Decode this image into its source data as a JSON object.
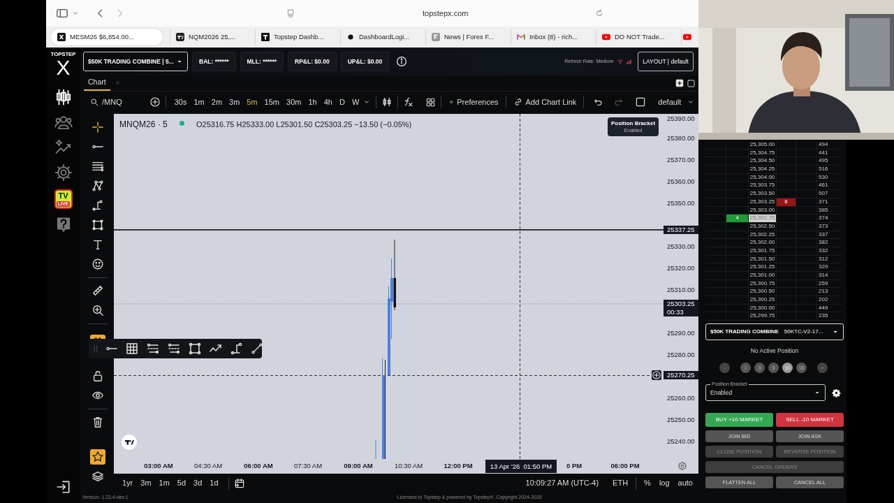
{
  "browser": {
    "url": "topstepx.com",
    "tabs": [
      {
        "kind": "topstep",
        "label": "MESM26 $6,854.00...",
        "selected": true
      },
      {
        "kind": "tradingview",
        "label": "NQM2026 25,...",
        "selected": false
      },
      {
        "kind": "dashboard",
        "label": "Topstep Dashb...",
        "selected": false
      },
      {
        "kind": "dot",
        "label": "DashboardLogi...",
        "selected": false
      },
      {
        "kind": "news",
        "label": "News | Forex F...",
        "selected": false
      },
      {
        "kind": "mail",
        "label": "Inbox (8) - rich...",
        "selected": false
      },
      {
        "kind": "youtube",
        "label": "DO NOT Trade...",
        "selected": false
      },
      {
        "kind": "youtube",
        "selected": false
      }
    ]
  },
  "logo": {
    "top": "TOPSTEP",
    "main": "X"
  },
  "nav": [
    {
      "kind": "candles",
      "selected": true
    },
    {
      "kind": "community",
      "selected": false
    },
    {
      "kind": "insights",
      "selected": false
    },
    {
      "kind": "settings",
      "selected": false
    },
    {
      "kind": "tv_live",
      "badge": "TV",
      "badge_sub": "LIVE",
      "selected": false
    },
    {
      "kind": "help",
      "selected": false
    }
  ],
  "header": {
    "account": "$50K TRADING COMBINE | 5...",
    "stats": [
      "BAL: ******",
      "MLL: ******",
      "RP&L: $0.00",
      "UP&L: $0.00"
    ],
    "refresh_rate": "Refresh Rate: Medium",
    "layout": "LAYOUT | default"
  },
  "chart_tabs": [
    {
      "label": "Chart",
      "close": "X",
      "selected": true
    }
  ],
  "chart_toolbar": {
    "symbol": "/MNQ",
    "intervals": [
      {
        "label": "30s",
        "selected": false
      },
      {
        "label": "1m",
        "selected": false
      },
      {
        "label": "2m",
        "selected": false
      },
      {
        "label": "3m",
        "selected": false
      },
      {
        "label": "5m",
        "selected": true
      },
      {
        "label": "15m",
        "selected": false
      },
      {
        "label": "30m",
        "selected": false
      },
      {
        "label": "1h",
        "selected": false
      },
      {
        "label": "4h",
        "selected": false
      },
      {
        "label": "D",
        "selected": false
      },
      {
        "label": "W",
        "selected": false
      }
    ],
    "preferences": "Preferences",
    "chart_link": "Add Chart Link",
    "template": "default"
  },
  "chart": {
    "legend": {
      "symbol": "MNQM26 · 5",
      "live": true,
      "ohlc": "O25316.75 H25333.00 L25301.50 C25303.25 −13.50 (−0.05%)"
    },
    "bracket_badge": {
      "title": "Position Bracket",
      "value": "Enabled"
    },
    "price_ticks": [
      "25390.00",
      "25380.00",
      "25370.00",
      "25360.00",
      "25350.00",
      "25330.00",
      "25320.00",
      "25310.00",
      "25290.00",
      "25280.00",
      "25260.00",
      "25250.00",
      "25240.00"
    ],
    "price_markers": [
      {
        "kind": "line",
        "label": "25337.25"
      },
      {
        "kind": "last",
        "label": "25303.25",
        "sub": "00:33"
      },
      {
        "kind": "crosshair",
        "label": "25270.25"
      }
    ],
    "time_ticks": [
      {
        "label": "03:00 AM",
        "major": true
      },
      {
        "label": "04:30 AM",
        "major": false
      },
      {
        "label": "06:00 AM",
        "major": true
      },
      {
        "label": "07:30 AM",
        "major": false
      },
      {
        "label": "09:00 AM",
        "major": true
      },
      {
        "label": "10:30 AM",
        "major": false
      },
      {
        "label": "12:00 PM",
        "major": true
      },
      {
        "label": "0 PM",
        "major": true
      },
      {
        "label": "06:00 PM",
        "major": true
      }
    ],
    "crosshair_time": "13 Apr '26  01:50 PM"
  },
  "range_bar": {
    "ranges": [
      "1yr",
      "3m",
      "1m",
      "5d",
      "3d",
      "1d"
    ],
    "clock": "10:09:27 AM (UTC-4)",
    "session": "ETH",
    "scale_options": [
      "%",
      "log",
      "auto"
    ]
  },
  "footer": {
    "version": "Version: 1.23.4-dev.1",
    "license": "Licensed to Topstep & powered by TopstepX. Copyright 2024-2026"
  },
  "dom_ladder": [
    {
      "price": "25,305.00",
      "volume": "494",
      "last": false
    },
    {
      "price": "25,304.75",
      "volume": "441",
      "last": false
    },
    {
      "price": "25,304.50",
      "volume": "495",
      "last": false
    },
    {
      "price": "25,304.25",
      "volume": "516",
      "last": false
    },
    {
      "price": "25,304.00",
      "volume": "530",
      "last": false
    },
    {
      "price": "25,303.75",
      "volume": "461",
      "last": false
    },
    {
      "price": "25,303.50",
      "volume": "507",
      "last": false
    },
    {
      "price": "25,303.25",
      "volume": "371",
      "ask": "6",
      "last": false
    },
    {
      "price": "25,303.00",
      "volume": "385",
      "last": false
    },
    {
      "price": "25,302.75",
      "volume": "374",
      "bid": "4",
      "last": true
    },
    {
      "price": "25,302.50",
      "volume": "373",
      "last": false
    },
    {
      "price": "25,302.25",
      "volume": "337",
      "last": false
    },
    {
      "price": "25,302.00",
      "volume": "382",
      "last": false
    },
    {
      "price": "25,301.75",
      "volume": "332",
      "last": false
    },
    {
      "price": "25,301.50",
      "volume": "312",
      "last": false
    },
    {
      "price": "25,301.25",
      "volume": "329",
      "last": false
    },
    {
      "price": "25,301.00",
      "volume": "314",
      "last": false
    },
    {
      "price": "25,300.75",
      "volume": "259",
      "last": false
    },
    {
      "price": "25,300.50",
      "volume": "213",
      "last": false
    },
    {
      "price": "25,300.25",
      "volume": "202",
      "last": false
    },
    {
      "price": "25,300.00",
      "volume": "449",
      "last": false
    },
    {
      "price": "25,299.75",
      "volume": "235",
      "last": false
    }
  ],
  "order_entry": {
    "account": "$50K TRADING COMBINE",
    "account_id": "50KTC-V2-17...",
    "status": "No Active Position",
    "quantities": [
      {
        "label": "-",
        "kind": "step",
        "selected": false
      },
      {
        "label": "1",
        "kind": "qty",
        "selected": false
      },
      {
        "label": "3",
        "kind": "qty",
        "selected": false
      },
      {
        "label": "5",
        "kind": "qty",
        "selected": false
      },
      {
        "label": "10",
        "kind": "qty",
        "selected": true
      },
      {
        "label": "15",
        "kind": "qty",
        "selected": false
      },
      {
        "label": "+",
        "kind": "step",
        "selected": false
      }
    ],
    "bracket": {
      "label": "Position Bracket",
      "value": "Enabled"
    },
    "buttons": [
      {
        "label": "BUY +10 MARKET",
        "kind": "buy",
        "disabled": false
      },
      {
        "label": "SELL -10 MARKET",
        "kind": "sell",
        "disabled": false
      },
      {
        "label": "JOIN BID",
        "kind": "plain",
        "disabled": false
      },
      {
        "label": "JOIN ASK",
        "kind": "plain",
        "disabled": false
      },
      {
        "label": "CLOSE POSITION",
        "kind": "plain",
        "disabled": true
      },
      {
        "label": "REVERSE POSITION",
        "kind": "plain",
        "disabled": true
      },
      {
        "label": "CANCEL ORDERS",
        "kind": "wide",
        "disabled": true
      },
      {
        "label": "FLATTEN ALL",
        "kind": "plain",
        "disabled": false
      },
      {
        "label": "CANCEL ALL",
        "kind": "plain",
        "disabled": false
      }
    ]
  }
}
